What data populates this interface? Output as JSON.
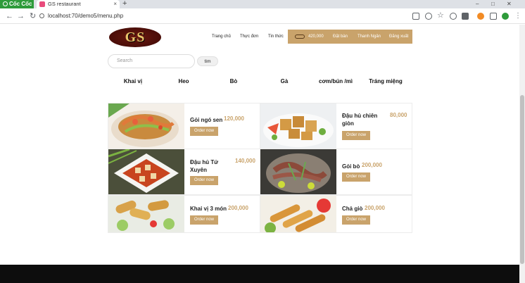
{
  "browser": {
    "brand": "Cốc Cốc",
    "tab_title": "GS restaurant",
    "tab_close": "×",
    "new_tab": "+",
    "url": "localhost:70/demo5/menu.php",
    "win_min": "–",
    "win_max": "□",
    "win_close": "✕",
    "back": "←",
    "forward": "→",
    "reload": "↻"
  },
  "site": {
    "logo": "GS",
    "nav": [
      "Trang chủ",
      "Thực đơn",
      "Tin thức"
    ],
    "cart_total": "420,000",
    "account": [
      "Đặt bàn",
      "Thanh Ngân",
      "Đăng xuất"
    ]
  },
  "search": {
    "placeholder": "Search",
    "button": "tìm"
  },
  "categories": [
    "Khai vị",
    "Heo",
    "Bò",
    "Gà",
    "cơm/bún /mì",
    "Tráng miệng"
  ],
  "order_label": "Order now",
  "dishes": [
    {
      "name": "Gỏi ngó sen",
      "price": "120,000"
    },
    {
      "name": "Đậu hủ chiên giòn",
      "price": "80,000"
    },
    {
      "name": "Đậu hủ Tứ Xuyên",
      "price": "140,000"
    },
    {
      "name": "Gỏi bò",
      "price": "200,000"
    },
    {
      "name": "Khai vị 3 món",
      "price": "200,000"
    },
    {
      "name": "Chả giò",
      "price": "200,000"
    }
  ],
  "colors": {
    "accent": "#c9a36b",
    "footer": "#0d0d0d"
  }
}
